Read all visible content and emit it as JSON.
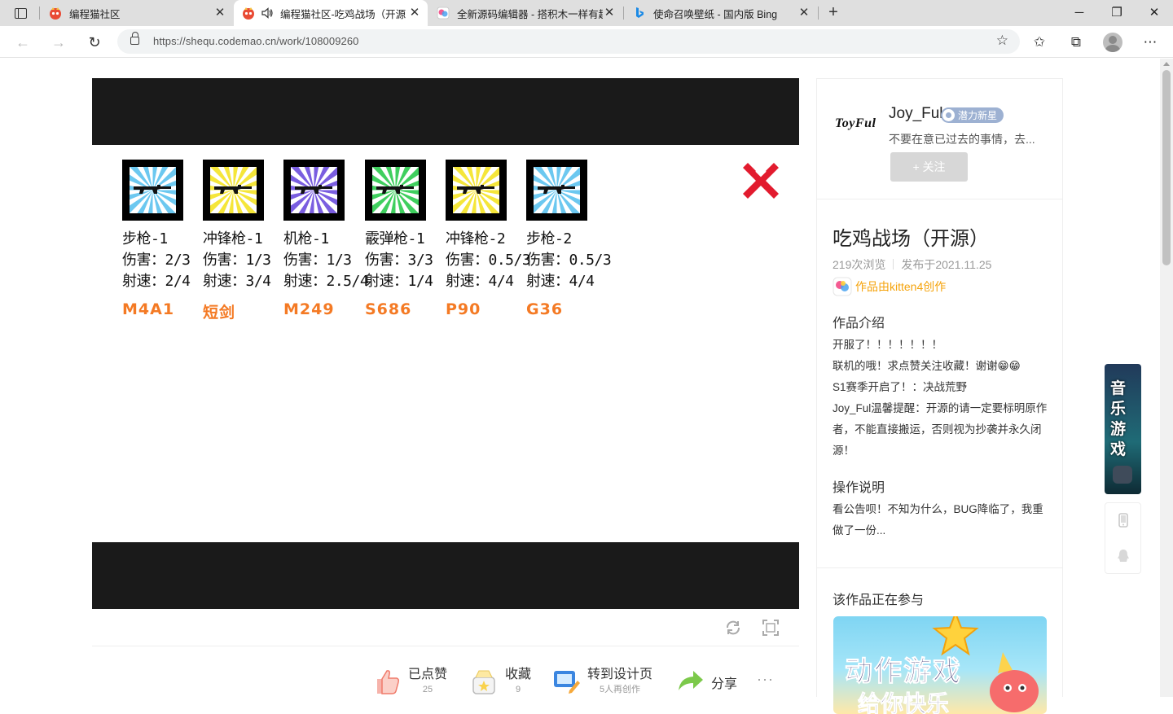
{
  "browser": {
    "tabs": [
      {
        "title": "编程猫社区",
        "active": false
      },
      {
        "title": "编程猫社区-吃鸡战场（开源",
        "active": true
      },
      {
        "title": "全新源码编辑器 - 搭积木一样有趣",
        "active": false
      },
      {
        "title": "使命召唤壁纸 - 国内版 Bing",
        "active": false
      }
    ],
    "url": "https://shequ.codemao.cn/work/108009260"
  },
  "game": {
    "weapons": [
      {
        "type": "步枪-1",
        "damage": "伤害：2/3",
        "rate": "射速：2/4",
        "code": "M4A1",
        "burst": "#6cc8f0"
      },
      {
        "type": "冲锋枪-1",
        "damage": "伤害：1/3",
        "rate": "射速：3/4",
        "code": "短剑",
        "burst": "#f5e63a"
      },
      {
        "type": "机枪-1",
        "damage": "伤害：1/3",
        "rate": "射速：2.5/4",
        "code": "M249",
        "burst": "#7a5ee0"
      },
      {
        "type": "霰弹枪-1",
        "damage": "伤害：3/3",
        "rate": "射速：1/4",
        "code": "S686",
        "burst": "#3fcf5e"
      },
      {
        "type": "冲锋枪-2",
        "damage": "伤害：0.5/3",
        "rate": "射速：4/4",
        "code": "P90",
        "burst": "#f5e63a"
      },
      {
        "type": "步枪-2",
        "damage": "伤害：0.5/3",
        "rate": "射速：4/4",
        "code": "G36",
        "burst": "#6cc8f0"
      }
    ]
  },
  "actions": {
    "like": {
      "label": "已点赞",
      "count": "25"
    },
    "collect": {
      "label": "收藏",
      "count": "9"
    },
    "remix": {
      "label": "转到设计页",
      "count": "5人再创作"
    },
    "share": {
      "label": "分享"
    },
    "more": "···"
  },
  "author": {
    "logo": "ToyFul",
    "name": "Joy_Ful",
    "badge": "潜力新星",
    "motto": "不要在意已过去的事情，去...",
    "follow": "+ 关注"
  },
  "work": {
    "title": "吃鸡战场（开源）",
    "views": "219次浏览",
    "published": "发布于2021.11.25",
    "tool": "作品由kitten4创作",
    "intro_heading": "作品介绍",
    "intro_lines": [
      "开服了！！！！！！！",
      "联机的哦！求点赞关注收藏！谢谢😁😁",
      "S1赛季开启了！：决战荒野",
      "Joy_Ful温馨提醒：开源的请一定要标明原作者，不能直接搬运，否则视为抄袭并永久闭源！"
    ],
    "ops_heading": "操作说明",
    "ops_text": "看公告呗！不知为什么，BUG降临了，我重做了一份...",
    "event_heading": "该作品正在参与",
    "event_banner": {
      "line1": "动作游戏",
      "line2": "给你快乐"
    }
  },
  "floating_ad": {
    "text": "音乐游戏"
  },
  "colors": {
    "accent_orange": "#f47a24",
    "tool_gold": "#f5a30b",
    "badge_blue": "#9db1d2"
  }
}
